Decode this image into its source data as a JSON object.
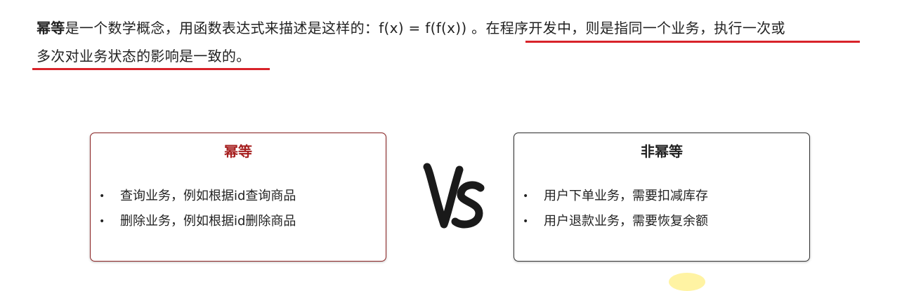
{
  "intro": {
    "term": "幂等",
    "line1_rest": "是一个数学概念，用函数表达式来描述是这样的：f(x) = f(f(x)) 。在程序开发中，则是指同一个业务，执行一次或",
    "line2": "多次对业务状态的影响是一致的。"
  },
  "left_card": {
    "title": "幂等",
    "items": [
      "查询业务，例如根据id查询商品",
      "删除业务，例如根据id删除商品"
    ]
  },
  "right_card": {
    "title": "非幂等",
    "items": [
      "用户下单业务，需要扣减库存",
      "用户退款业务，需要恢复余额"
    ]
  },
  "vs_graphic": "VS",
  "bullet_char": "•",
  "colors": {
    "underline": "#d8232a",
    "left_title": "#a61f1f",
    "left_border": "#8b2323"
  }
}
